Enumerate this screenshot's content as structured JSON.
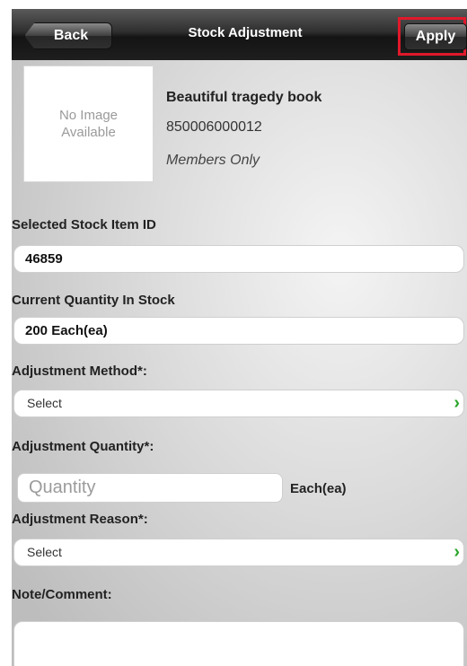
{
  "header": {
    "back_label": "Back",
    "title": "Stock Adjustment",
    "apply_label": "Apply"
  },
  "product": {
    "image_placeholder": "No Image Available",
    "name": "Beautiful tragedy book",
    "code": "850006000012",
    "note": "Members Only"
  },
  "form": {
    "stock_item_id_label": "Selected Stock Item ID",
    "stock_item_id_value": "46859",
    "current_qty_label": "Current Quantity In Stock",
    "current_qty_value": "200 Each(ea)",
    "adj_method_label": "Adjustment Method*:",
    "adj_method_value": "Select",
    "adj_qty_label": "Adjustment Quantity*:",
    "adj_qty_placeholder": "Quantity",
    "adj_qty_unit": "Each(ea)",
    "adj_reason_label": "Adjustment Reason*:",
    "adj_reason_value": "Select",
    "note_label": "Note/Comment:"
  },
  "icons": {
    "chevron": "›"
  },
  "colors": {
    "highlight": "#e0192b",
    "chevron": "#2aa52a"
  }
}
